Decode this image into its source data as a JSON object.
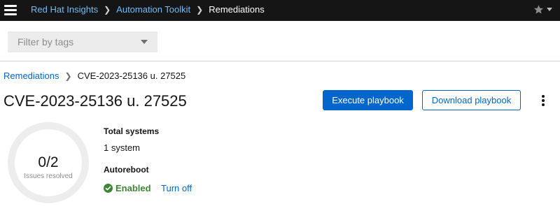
{
  "masthead": {
    "breadcrumbs": [
      {
        "label": "Red Hat Insights"
      },
      {
        "label": "Automation Toolkit"
      },
      {
        "label": "Remediations"
      }
    ]
  },
  "filter": {
    "placeholder": "Filter by tags"
  },
  "breadcrumb": {
    "parent": "Remediations",
    "current": "CVE-2023-25136 u. 27525"
  },
  "page": {
    "title": "CVE-2023-25136 u. 27525",
    "execute_label": "Execute playbook",
    "download_label": "Download playbook"
  },
  "progress": {
    "value": "0/2",
    "label": "Issues resolved",
    "resolved_fraction": 0
  },
  "details": {
    "total_systems_label": "Total systems",
    "total_systems_value": "1 system",
    "autoreboot_label": "Autoreboot",
    "autoreboot_status": "Enabled",
    "autoreboot_action": "Turn off"
  },
  "colors": {
    "primary": "#0066cc",
    "success": "#3e8635",
    "masthead_bg": "#151515"
  },
  "icons": {
    "menu": "hamburger-icon",
    "favorite": "star-icon",
    "options": "kebab-icon",
    "status": "check-circle-icon"
  }
}
